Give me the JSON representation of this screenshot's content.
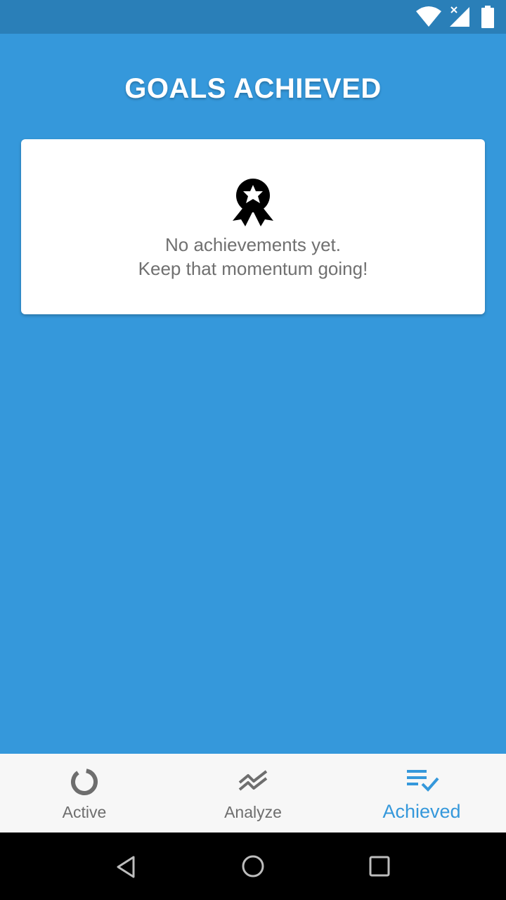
{
  "colors": {
    "background": "#3598db",
    "status_bar": "#2a7fb8",
    "accent": "#3598db",
    "card": "#ffffff",
    "muted_text": "#707070"
  },
  "status_bar": {
    "icons": [
      "wifi-icon",
      "signal-no-sim-icon",
      "battery-icon"
    ]
  },
  "header": {
    "title": "GOALS ACHIEVED"
  },
  "empty_state": {
    "icon": "award-ribbon-icon",
    "line1": "No achievements yet.",
    "line2": "Keep that momentum going!"
  },
  "bottom_nav": {
    "items": [
      {
        "label": "Active",
        "icon": "ring-progress-icon",
        "selected": false
      },
      {
        "label": "Analyze",
        "icon": "trend-chart-icon",
        "selected": false
      },
      {
        "label": "Achieved",
        "icon": "checklist-icon",
        "selected": true
      }
    ]
  },
  "system_nav": {
    "icons": [
      "back-icon",
      "home-icon",
      "recents-icon"
    ]
  }
}
